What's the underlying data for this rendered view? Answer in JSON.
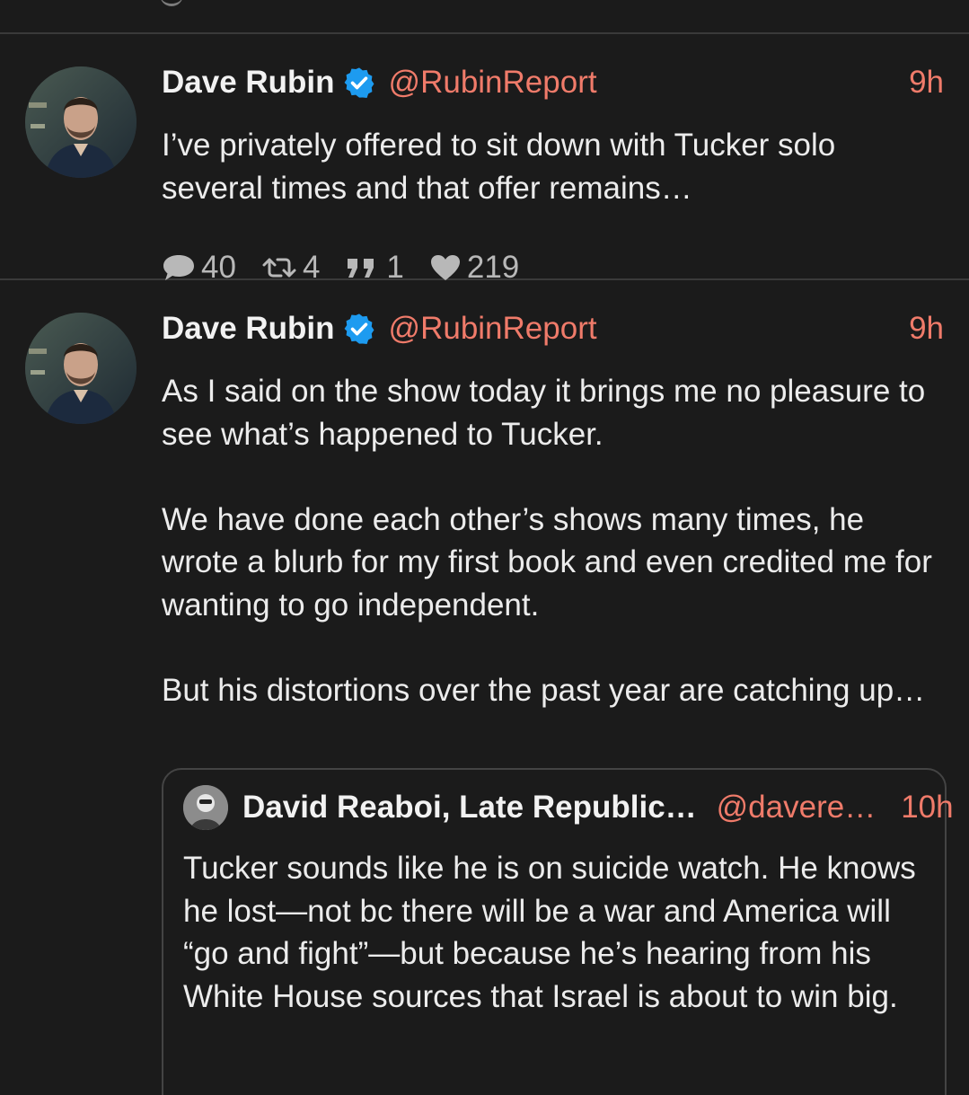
{
  "feed": {
    "tweets": [
      {
        "author": "Dave Rubin",
        "handle": "@RubinReport",
        "time": "9h",
        "text": "I’ve privately offered to sit down with Tucker solo several times and that offer remains…",
        "stats": {
          "replies": "40",
          "retweets": "4",
          "quotes": "1",
          "likes": "219"
        }
      },
      {
        "author": "Dave Rubin",
        "handle": "@RubinReport",
        "time": "9h",
        "paragraphs": [
          "As I said on the show today it brings me no pleasure to see what’s happened to Tucker.",
          "We have done each other’s shows many times, he wrote a blurb for my first book and even credited me for wanting to go independent.",
          "But his distortions over the past year are catching up…"
        ],
        "quote": {
          "author": "David Reaboi, Late Republic…",
          "handle": "@davere…",
          "time": "10h",
          "text": "Tucker sounds like he is on suicide watch. He knows he lost—not bc there will be a war and America will “go and fight”—but because he’s hearing from his White House sources that Israel is about to win big."
        }
      }
    ]
  },
  "colors": {
    "background": "#1b1b1b",
    "accent": "#f07b6a",
    "verified": "#1d9bf0",
    "muted": "#b8b8b8"
  }
}
